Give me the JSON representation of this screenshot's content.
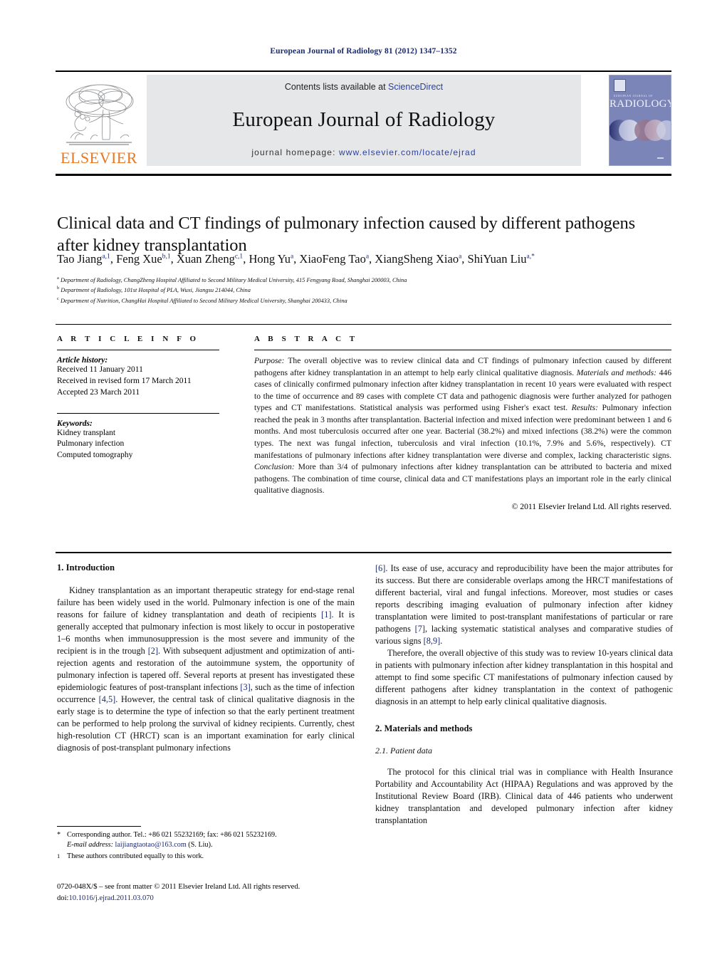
{
  "header": {
    "running_head": "European Journal of Radiology 81 (2012) 1347–1352",
    "contents_prefix": "Contents lists available at ",
    "contents_link": "ScienceDirect",
    "journal_title": "European Journal of Radiology",
    "homepage_prefix": "journal homepage: ",
    "homepage_url": "www.elsevier.com/locate/ejrad",
    "publisher_wordmark": "ELSEVIER",
    "cover": {
      "superline": "EUROPEAN JOURNAL OF",
      "title": "RADIOLOGY"
    }
  },
  "article": {
    "title": "Clinical data and CT findings of pulmonary infection caused by different pathogens after kidney transplantation",
    "authors_html": "Tao Jiang<sup>a,1</sup>, Feng Xue<sup>b,1</sup>, Xuan Zheng<sup>c,1</sup>, Hong Yu<sup>a</sup>, XiaoFeng Tao<sup>a</sup>, XiangSheng Xiao<sup>a</sup>, ShiYuan Liu<sup>a,*</sup>",
    "affiliations": [
      {
        "mark": "a",
        "text": "Department of Radiology, ChangZheng Hospital Affiliated to Second Military Medical University, 415 Fengyang Road, Shanghai 200003, China"
      },
      {
        "mark": "b",
        "text": "Department of Radiology, 101st Hospital of PLA, Wuxi, Jiangsu 214044, China"
      },
      {
        "mark": "c",
        "text": "Department of Nutrition, ChangHai Hospital Affiliated to Second Military Medical University, Shanghai 200433, China"
      }
    ]
  },
  "article_info": {
    "section_label": "A R T I C L E   I N F O",
    "history_label": "Article history:",
    "history": [
      "Received 11 January 2011",
      "Received in revised form 17 March 2011",
      "Accepted 23 March 2011"
    ],
    "keywords_label": "Keywords:",
    "keywords": [
      "Kidney transplant",
      "Pulmonary infection",
      "Computed tomography"
    ]
  },
  "abstract": {
    "section_label": "A B S T R A C T",
    "paragraphs": [
      {
        "lead": "Purpose:",
        "text": " The overall objective was to review clinical data and CT findings of pulmonary infection caused by different pathogens after kidney transplantation in an attempt to help early clinical qualitative diagnosis."
      },
      {
        "lead": "Materials and methods:",
        "text": " 446 cases of clinically confirmed pulmonary infection after kidney transplantation in recent 10 years were evaluated with respect to the time of occurrence and 89 cases with complete CT data and pathogenic diagnosis were further analyzed for pathogen types and CT manifestations. Statistical analysis was performed using Fisher's exact test."
      },
      {
        "lead": "Results:",
        "text": " Pulmonary infection reached the peak in 3 months after transplantation. Bacterial infection and mixed infection were predominant between 1 and 6 months. And most tuberculosis occurred after one year. Bacterial (38.2%) and mixed infections (38.2%) were the common types. The next was fungal infection, tuberculosis and viral infection (10.1%, 7.9% and 5.6%, respectively). CT manifestations of pulmonary infections after kidney transplantation were diverse and complex, lacking characteristic signs."
      },
      {
        "lead": "Conclusion:",
        "text": " More than 3/4 of pulmonary infections after kidney transplantation can be attributed to bacteria and mixed pathogens. The combination of time course, clinical data and CT manifestations plays an important role in the early clinical qualitative diagnosis."
      }
    ],
    "copyright": "© 2011 Elsevier Ireland Ltd. All rights reserved."
  },
  "body": {
    "introduction_heading": "1. Introduction",
    "intro_left_html": "Kidney transplantation as an important therapeutic strategy for end-stage renal failure has been widely used in the world. Pulmonary infection is one of the main reasons for failure of kidney transplantation and death of recipients <span class=\"ref\">[1]</span>. It is generally accepted that pulmonary infection is most likely to occur in postoperative 1–6 months when immunosuppression is the most severe and immunity of the recipient is in the trough <span class=\"ref\">[2]</span>. With subsequent adjustment and optimization of anti-rejection agents and restoration of the autoimmune system, the opportunity of pulmonary infection is tapered off. Several reports at present has investigated these epidemiologic features of post-transplant infections <span class=\"ref\">[3]</span>, such as the time of infection occurrence <span class=\"ref\">[4,5]</span>. However, the central task of clinical qualitative diagnosis in the early stage is to determine the type of infection so that the early pertinent treatment can be performed to help prolong the survival of kidney recipients. Currently, chest high-resolution CT (HRCT) scan is an important examination for early clinical diagnosis of post-transplant pulmonary infections",
    "intro_right_html": "<span class=\"ref\">[6]</span>. Its ease of use, accuracy and reproducibility have been the major attributes for its success. But there are considerable overlaps among the HRCT manifestations of different bacterial, viral and fungal infections. Moreover, most studies or cases reports describing imaging evaluation of pulmonary infection after kidney transplantation were limited to post-transplant manifestations of particular or rare pathogens <span class=\"ref\">[7]</span>, lacking systematic statistical analyses and comparative studies of various signs <span class=\"ref\">[8,9]</span>.",
    "intro_right_html_2": "Therefore, the overall objective of this study was to review 10-years clinical data in patients with pulmonary infection after kidney transplantation in this hospital and attempt to find some specific CT manifestations of pulmonary infection caused by different pathogens after kidney transplantation in the context of pathogenic diagnosis in an attempt to help early clinical qualitative diagnosis.",
    "methods_heading": "2. Materials and methods",
    "methods_subheading": "2.1. Patient data",
    "methods_para": "The protocol for this clinical trial was in compliance with Health Insurance Portability and Accountability Act (HIPAA) Regulations and was approved by the Institutional Review Board (IRB). Clinical data of 446 patients who underwent kidney transplantation and developed pulmonary infection after kidney transplantation"
  },
  "footnotes": {
    "corresponding_mark": "*",
    "corresponding_text": "Corresponding author. Tel.: +86 021 55232169; fax: +86 021 55232169.",
    "email_label": "E-mail address:",
    "email_value": "laijiangtaotao@163.com",
    "email_suffix": "(S. Liu).",
    "equal_mark": "1",
    "equal_text": "These authors contributed equally to this work."
  },
  "imprint": {
    "line1": "0720-048X/$ – see front matter © 2011 Elsevier Ireland Ltd. All rights reserved.",
    "doi_prefix": "doi:",
    "doi_value": "10.1016/j.ejrad.2011.03.070"
  },
  "colors": {
    "link": "#2b3f9e",
    "ref": "#1b2a6b",
    "elsevier_orange": "#E87722",
    "banner_gray": "#e6e7e8",
    "cover_blue": "#7b85b8"
  }
}
